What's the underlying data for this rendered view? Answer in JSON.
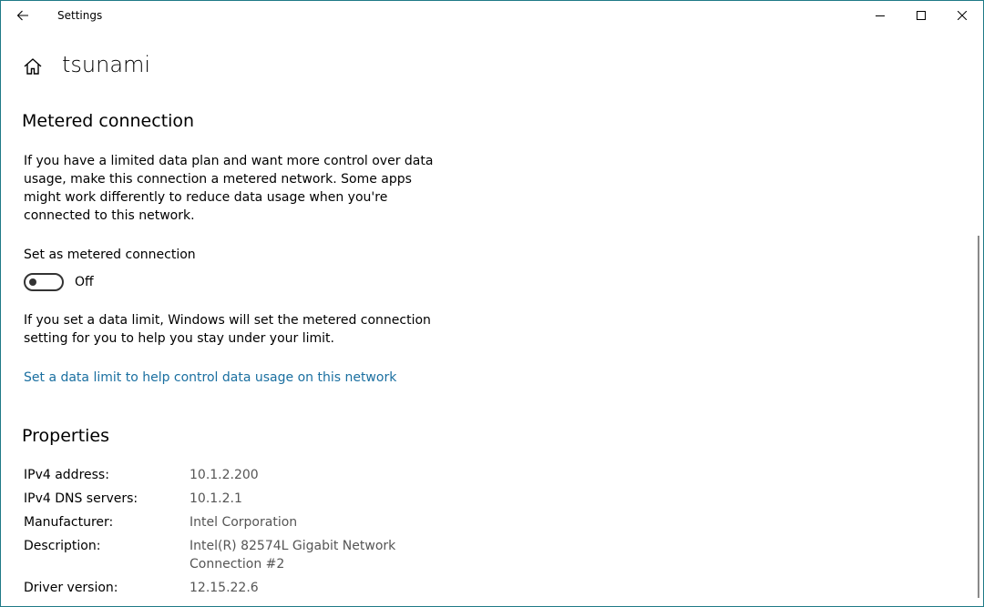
{
  "window": {
    "title": "Settings",
    "accent_color": "#1f7a87"
  },
  "header": {
    "page_title": "tsunami"
  },
  "metered": {
    "section_title": "Metered connection",
    "description": "If you have a limited data plan and want more control over data usage, make this connection a metered network. Some apps might work differently to reduce data usage when you're connected to this network.",
    "toggle_label": "Set as metered connection",
    "toggle_state": "Off",
    "toggle_on": false,
    "limit_info": "If you set a data limit, Windows will set the metered connection setting for you to help you stay under your limit.",
    "limit_link": "Set a data limit to help control data usage on this network",
    "link_color": "#1a6fa0"
  },
  "properties": {
    "section_title": "Properties",
    "rows": [
      {
        "label": "IPv4 address:",
        "value": "10.1.2.200"
      },
      {
        "label": "IPv4 DNS servers:",
        "value": "10.1.2.1"
      },
      {
        "label": "Manufacturer:",
        "value": "Intel Corporation"
      },
      {
        "label": "Description:",
        "value": "Intel(R) 82574L Gigabit Network Connection #2"
      },
      {
        "label": "Driver version:",
        "value": "12.15.22.6"
      }
    ]
  },
  "icons": {
    "back": "back-arrow-icon",
    "home": "home-icon",
    "minimize": "minimize-icon",
    "maximize": "maximize-icon",
    "close": "close-icon"
  }
}
